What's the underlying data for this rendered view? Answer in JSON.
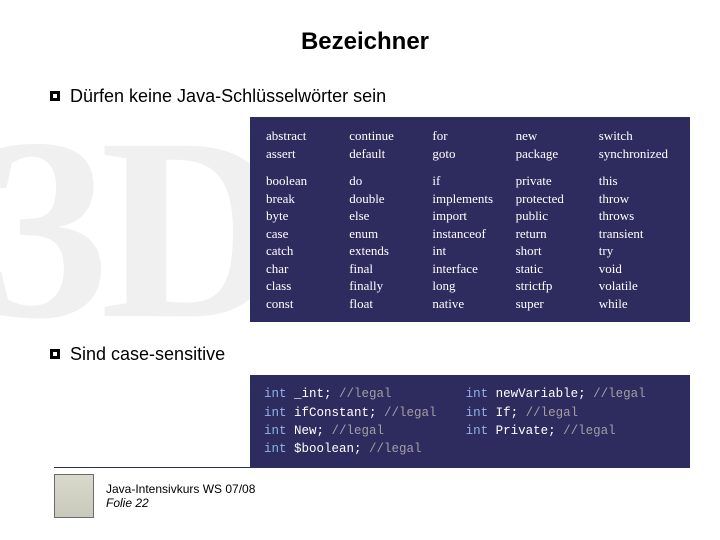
{
  "title": "Bezeichner",
  "bullets": {
    "b1": "Dürfen keine Java-Schlüsselwörter sein",
    "b2": "Sind case-sensitive"
  },
  "keywords": {
    "row1": {
      "c0": "abstract",
      "c1": "continue",
      "c2": "for",
      "c3": "new",
      "c4": "switch"
    },
    "row2": {
      "c0": "assert",
      "c1": "default",
      "c2": "goto",
      "c3": "package",
      "c4": "synchronized"
    },
    "rows": [
      {
        "c0": "boolean",
        "c1": "do",
        "c2": "if",
        "c3": "private",
        "c4": "this"
      },
      {
        "c0": "break",
        "c1": "double",
        "c2": "implements",
        "c3": "protected",
        "c4": "throw"
      },
      {
        "c0": "byte",
        "c1": "else",
        "c2": "import",
        "c3": "public",
        "c4": "throws"
      },
      {
        "c0": "case",
        "c1": "enum",
        "c2": "instanceof",
        "c3": "return",
        "c4": "transient"
      },
      {
        "c0": "catch",
        "c1": "extends",
        "c2": "int",
        "c3": "short",
        "c4": "try"
      },
      {
        "c0": "char",
        "c1": "final",
        "c2": "interface",
        "c3": "static",
        "c4": "void"
      },
      {
        "c0": "class",
        "c1": "finally",
        "c2": "long",
        "c3": "strictfp",
        "c4": "volatile"
      },
      {
        "c0": "const",
        "c1": "float",
        "c2": "native",
        "c3": "super",
        "c4": "while"
      }
    ]
  },
  "code": {
    "kw_int": "int",
    "l1a_i": " _int;",
    "l1a_c": " //legal",
    "l1b_i": " newVariable;",
    "l1b_c": " //legal",
    "l2a_i": " ifConstant;",
    "l2a_c": " //legal",
    "l2b_i": " If;",
    "l2b_c": " //legal",
    "l3a_i": " New;",
    "l3a_c": " //legal",
    "l3b_i": " Private;",
    "l3b_c": " //legal",
    "l4a_i": " $boolean;",
    "l4a_c": " //legal"
  },
  "footer": {
    "line1": "Java-Intensivkurs WS 07/08",
    "line2": "Folie 22"
  }
}
